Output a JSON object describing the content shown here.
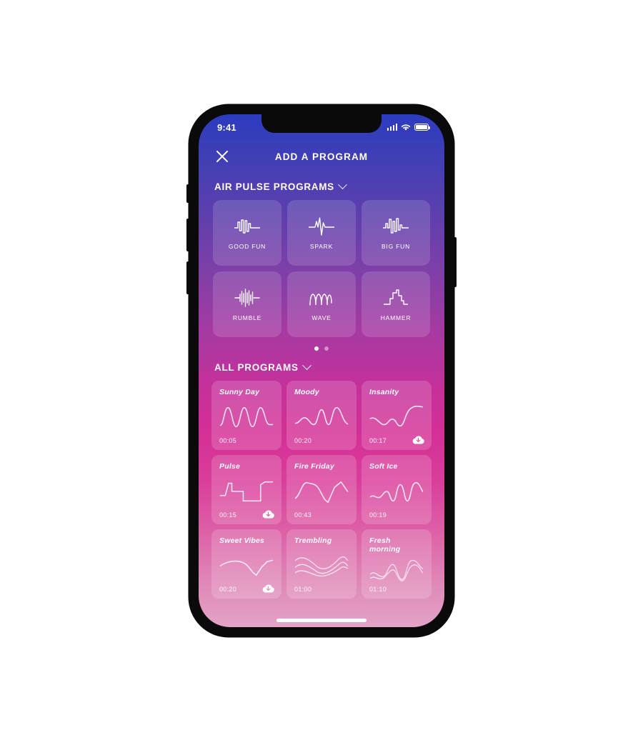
{
  "statusbar": {
    "time": "9:41",
    "signal_icon": "signal-bars-icon",
    "wifi_icon": "wifi-icon",
    "battery_icon": "battery-icon"
  },
  "navbar": {
    "close_icon": "close-icon",
    "title": "ADD A PROGRAM"
  },
  "airpulse": {
    "title": "AIR PULSE PROGRAMS",
    "chevron_icon": "chevron-down-icon",
    "items": [
      {
        "label": "GOOD FUN",
        "icon": "waveform-good-fun-icon"
      },
      {
        "label": "SPARK",
        "icon": "waveform-spark-icon"
      },
      {
        "label": "BIG FUN",
        "icon": "waveform-big-fun-icon"
      },
      {
        "label": "RUMBLE",
        "icon": "waveform-rumble-icon"
      },
      {
        "label": "WAVE",
        "icon": "waveform-wave-icon"
      },
      {
        "label": "HAMMER",
        "icon": "waveform-hammer-icon"
      }
    ],
    "pager": {
      "total": 2,
      "active": 1
    }
  },
  "allprograms": {
    "title": "ALL PROGRAMS",
    "chevron_icon": "chevron-down-icon",
    "items": [
      {
        "name": "Sunny Day",
        "time": "00:05",
        "cloud": false
      },
      {
        "name": "Moody",
        "time": "00:20",
        "cloud": false
      },
      {
        "name": "Insanity",
        "time": "00:17",
        "cloud": true
      },
      {
        "name": "Pulse",
        "time": "00:15",
        "cloud": true
      },
      {
        "name": "Fire Friday",
        "time": "00:43",
        "cloud": false
      },
      {
        "name": "Soft Ice",
        "time": "00:19",
        "cloud": false
      },
      {
        "name": "Sweet Vibes",
        "time": "00:20",
        "cloud": true
      },
      {
        "name": "Trembling",
        "time": "01:00",
        "cloud": false
      },
      {
        "name": "Fresh morning",
        "time": "01:10",
        "cloud": false
      }
    ]
  },
  "colors": {
    "gradient_top": "#2c3bbf",
    "gradient_mid": "#a53aa2",
    "gradient_bottom": "#e3a3c6",
    "frame": "#0a0a0a",
    "page_background": "#ffffff"
  }
}
